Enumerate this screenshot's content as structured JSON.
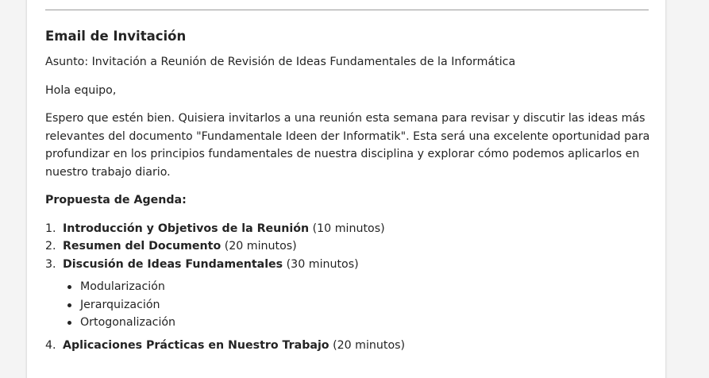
{
  "email": {
    "heading": "Email de Invitación",
    "subject": "Asunto: Invitación a Reunión de Revisión de Ideas Fundamentales de la Informática",
    "greeting": "Hola equipo,",
    "body": "Espero que estén bien. Quisiera invitarlos a una reunión esta semana para revisar y discutir las ideas más relevantes del documento \"Fundamentale Ideen der Informatik\". Esta será una excelente oportunidad para profundizar en los principios fundamentales de nuestra disciplina y explorar cómo podemos aplicarlos en nuestro trabajo diario.",
    "agenda_title": "Propuesta de Agenda:",
    "agenda": [
      {
        "num": "1.",
        "title": "Introducción y Objetivos de la Reunión",
        "duration": " (10 minutos)"
      },
      {
        "num": "2.",
        "title": "Resumen del Documento",
        "duration": " (20 minutos)"
      },
      {
        "num": "3.",
        "title": "Discusión de Ideas Fundamentales",
        "duration": " (30 minutos)"
      }
    ],
    "sub_items": [
      "Modularización",
      "Jerarquización",
      "Ortogonalización"
    ],
    "agenda_more": [
      {
        "num": "4.",
        "title": "Aplicaciones Prácticas en Nuestro Trabajo",
        "duration": " (20 minutos)"
      }
    ]
  }
}
